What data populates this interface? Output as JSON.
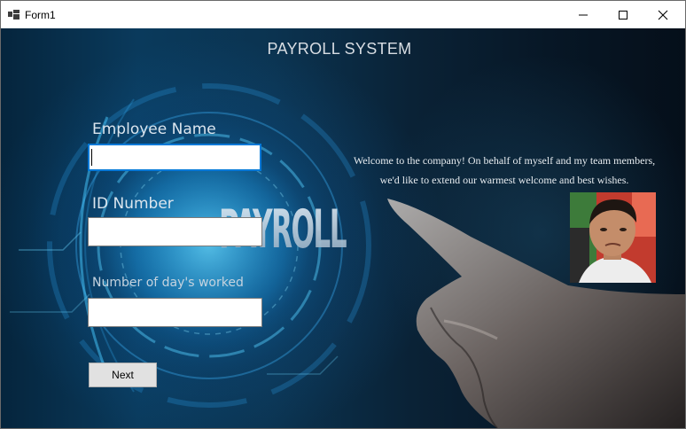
{
  "window": {
    "title": "Form1",
    "controls": {
      "minimize_icon": "minimize-icon",
      "maximize_icon": "maximize-icon",
      "close_icon": "close-icon"
    }
  },
  "header": {
    "title": "PAYROLL SYSTEM"
  },
  "background": {
    "wordmark": "PAYROLL"
  },
  "form": {
    "employee_name_label": "Employee Name",
    "employee_name_value": "",
    "id_number_label": "ID Number",
    "id_number_value": "",
    "days_worked_label": "Number of day's worked",
    "days_worked_value": "",
    "next_label": "Next"
  },
  "welcome": {
    "line1": "Welcome to the company! On behalf of myself and my team members,",
    "line2": "we'd like to extend our warmest welcome and best wishes."
  },
  "colors": {
    "accent_focus": "#0078d7",
    "text_light": "#dbe5ee",
    "background_dark": "#0a2236"
  }
}
